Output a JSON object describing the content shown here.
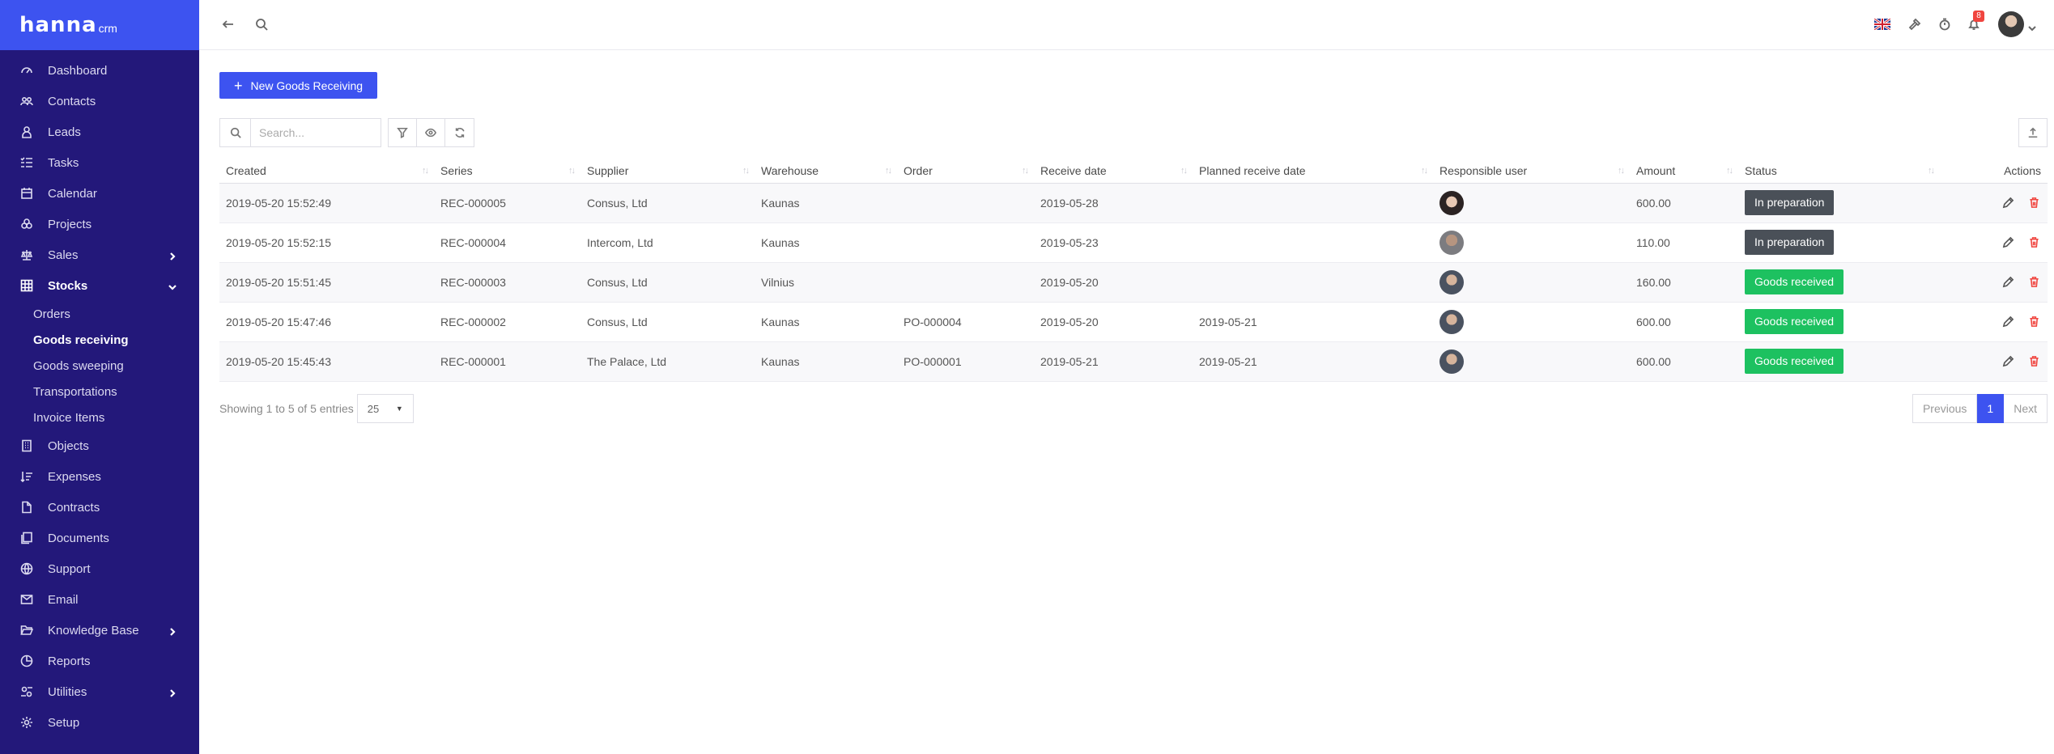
{
  "brand": {
    "name": "hanna",
    "suffix": "crm"
  },
  "sidebar": {
    "items": [
      {
        "label": "Dashboard",
        "icon": "dashboard-icon"
      },
      {
        "label": "Contacts",
        "icon": "contacts-icon"
      },
      {
        "label": "Leads",
        "icon": "leads-icon"
      },
      {
        "label": "Tasks",
        "icon": "tasks-icon"
      },
      {
        "label": "Calendar",
        "icon": "calendar-icon"
      },
      {
        "label": "Projects",
        "icon": "projects-icon"
      },
      {
        "label": "Sales",
        "icon": "scale-icon",
        "expandable": true
      },
      {
        "label": "Stocks",
        "icon": "grid-icon",
        "expanded": true
      },
      {
        "label": "Objects",
        "icon": "building-icon"
      },
      {
        "label": "Expenses",
        "icon": "expenses-icon"
      },
      {
        "label": "Contracts",
        "icon": "file-icon"
      },
      {
        "label": "Documents",
        "icon": "documents-icon"
      },
      {
        "label": "Support",
        "icon": "globe-icon"
      },
      {
        "label": "Email",
        "icon": "mail-icon"
      },
      {
        "label": "Knowledge Base",
        "icon": "folder-open-icon",
        "expandable": true
      },
      {
        "label": "Reports",
        "icon": "pie-chart-icon"
      },
      {
        "label": "Utilities",
        "icon": "utilities-icon",
        "expandable": true
      },
      {
        "label": "Setup",
        "icon": "gear-icon"
      }
    ],
    "stocks_sub": [
      {
        "label": "Orders"
      },
      {
        "label": "Goods receiving",
        "current": true
      },
      {
        "label": "Goods sweeping"
      },
      {
        "label": "Transportations"
      },
      {
        "label": "Invoice Items"
      }
    ]
  },
  "topbar": {
    "notification_count": "8"
  },
  "main": {
    "new_button": "New Goods Receiving",
    "search_placeholder": "Search...",
    "table": {
      "columns": [
        "Created",
        "Series",
        "Supplier",
        "Warehouse",
        "Order",
        "Receive date",
        "Planned receive date",
        "Responsible user",
        "Amount",
        "Status",
        "Actions"
      ],
      "rows": [
        {
          "created": "2019-05-20 15:52:49",
          "series": "REC-000005",
          "supplier": "Consus, Ltd",
          "warehouse": "Kaunas",
          "order": "",
          "receive_date": "2019-05-28",
          "planned": "",
          "user": "female",
          "amount": "600.00",
          "status": "In preparation",
          "status_kind": "prep"
        },
        {
          "created": "2019-05-20 15:52:15",
          "series": "REC-000004",
          "supplier": "Intercom, Ltd",
          "warehouse": "Kaunas",
          "order": "",
          "receive_date": "2019-05-23",
          "planned": "",
          "user": "grey",
          "amount": "110.00",
          "status": "In preparation",
          "status_kind": "prep"
        },
        {
          "created": "2019-05-20 15:51:45",
          "series": "REC-000003",
          "supplier": "Consus, Ltd",
          "warehouse": "Vilnius",
          "order": "",
          "receive_date": "2019-05-20",
          "planned": "",
          "user": "male",
          "amount": "160.00",
          "status": "Goods received",
          "status_kind": "recv"
        },
        {
          "created": "2019-05-20 15:47:46",
          "series": "REC-000002",
          "supplier": "Consus, Ltd",
          "warehouse": "Kaunas",
          "order": "PO-000004",
          "receive_date": "2019-05-20",
          "planned": "2019-05-21",
          "user": "male",
          "amount": "600.00",
          "status": "Goods received",
          "status_kind": "recv"
        },
        {
          "created": "2019-05-20 15:45:43",
          "series": "REC-000001",
          "supplier": "The Palace, Ltd",
          "warehouse": "Kaunas",
          "order": "PO-000001",
          "receive_date": "2019-05-21",
          "planned": "2019-05-21",
          "user": "male",
          "amount": "600.00",
          "status": "Goods received",
          "status_kind": "recv"
        }
      ]
    },
    "footer": {
      "info": "Showing 1 to 5 of 5 entries",
      "page_size": "25"
    },
    "pager": {
      "previous": "Previous",
      "current": "1",
      "next": "Next"
    }
  },
  "colors": {
    "sidebar_bg": "#23187a",
    "accent": "#3d53f0",
    "status_prep": "#4a5058",
    "status_received": "#1dc160",
    "delete": "#f0453f"
  }
}
